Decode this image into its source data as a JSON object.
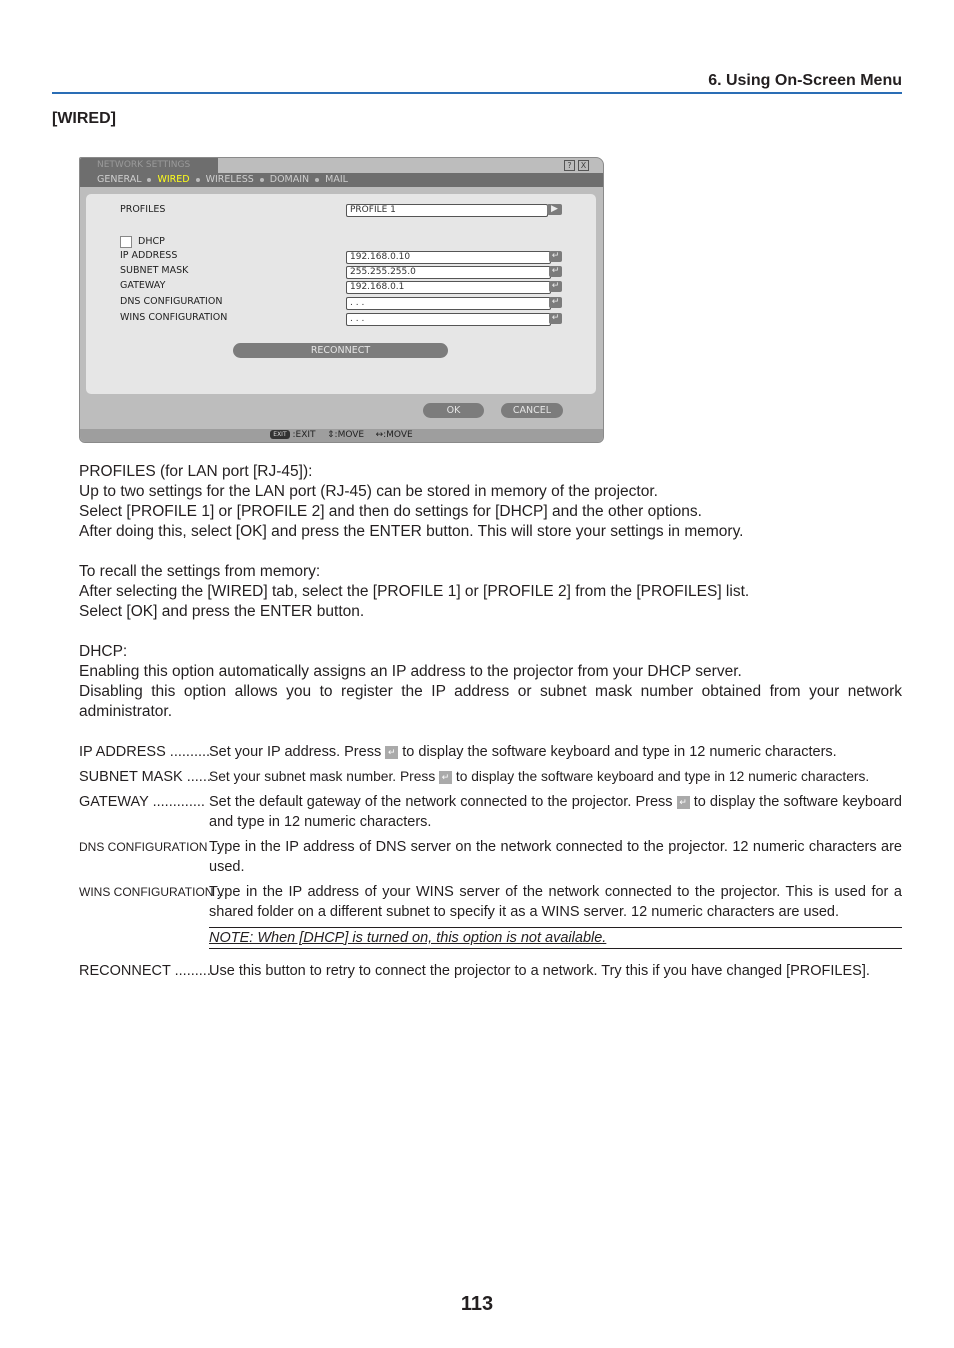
{
  "header": {
    "chapter": "6. Using On-Screen Menu",
    "section": "[WIRED]",
    "accent_color": "#2a6db5"
  },
  "osd": {
    "title": "NETWORK SETTINGS",
    "help_icon": "?",
    "close_icon": "X",
    "tabs": [
      {
        "label": "GENERAL",
        "active": false
      },
      {
        "label": "WIRED",
        "active": true
      },
      {
        "label": "WIRELESS",
        "active": false
      },
      {
        "label": "DOMAIN",
        "active": false
      },
      {
        "label": "MAIL",
        "active": false
      }
    ],
    "profiles_label": "PROFILES",
    "profiles_value": "PROFILE 1",
    "dhcp_label": "DHCP",
    "dhcp_checked": false,
    "fields": [
      {
        "label": "IP ADDRESS",
        "value": "192.168.0.10"
      },
      {
        "label": "SUBNET MASK",
        "value": "255.255.255.0"
      },
      {
        "label": "GATEWAY",
        "value": "192.168.0.1"
      },
      {
        "label": "DNS CONFIGURATION",
        "value": ". . ."
      },
      {
        "label": "WINS CONFIGURATION",
        "value": ". . ."
      }
    ],
    "reconnect": "RECONNECT",
    "ok": "OK",
    "cancel": "CANCEL",
    "footer": {
      "exit_key": "EXIT",
      "exit": ":EXIT",
      "move_v": ":MOVE",
      "move_h": ":MOVE"
    }
  },
  "paragraphs": {
    "p1": [
      "PROFILES (for LAN port [RJ-45]):",
      "Up to two settings for the LAN port (RJ-45) can be stored in memory of the projector.",
      "Select [PROFILE 1] or [PROFILE 2] and then do settings for [DHCP] and the other options.",
      "After doing this, select [OK] and press the ENTER button. This will store your settings in memory."
    ],
    "p2": [
      "To recall the settings from memory:",
      "After selecting the [WIRED] tab, select the [PROFILE 1] or [PROFILE 2] from the [PROFILES] list.",
      "Select [OK] and press the ENTER button."
    ],
    "p3": [
      "DHCP:",
      "Enabling this option automatically assigns an IP address to the projector from your DHCP server.",
      "Disabling this option allows you to register the IP address or subnet mask number obtained from your network administrator."
    ]
  },
  "definitions": [
    {
      "term": "IP ADDRESS ..........",
      "pre": "Set your IP address. Press ",
      "post": " to display the software keyboard and type in 12 numeric characters."
    },
    {
      "term": "SUBNET MASK ......",
      "pre": "Set your subnet mask number. Press ",
      "post": " to display the software keyboard and type in 12 numeric characters."
    },
    {
      "term": "GATEWAY .............",
      "pre": "Set the default gateway of the network connected to the projector. Press ",
      "post": " to display the software keyboard and type in 12 numeric characters."
    },
    {
      "term": "DNS CONFIGURATION ..",
      "text": "Type in the IP address of DNS server on the network connected to the projector. 12 numeric characters are used."
    },
    {
      "term": "WINS CONFIGURATION ..",
      "text": "Type in the IP address of your WINS server of the network connected to the projector. This is used for a shared folder on a different subnet to specify it as a WINS server. 12 numeric characters are used."
    },
    {
      "term": "RECONNECT ..........",
      "text": "Use this button to retry to connect the projector to a network. Try this if you have changed [PROFILES]."
    }
  ],
  "note": "NOTE: When [DHCP] is turned on, this option is not available.",
  "page_number": "113"
}
